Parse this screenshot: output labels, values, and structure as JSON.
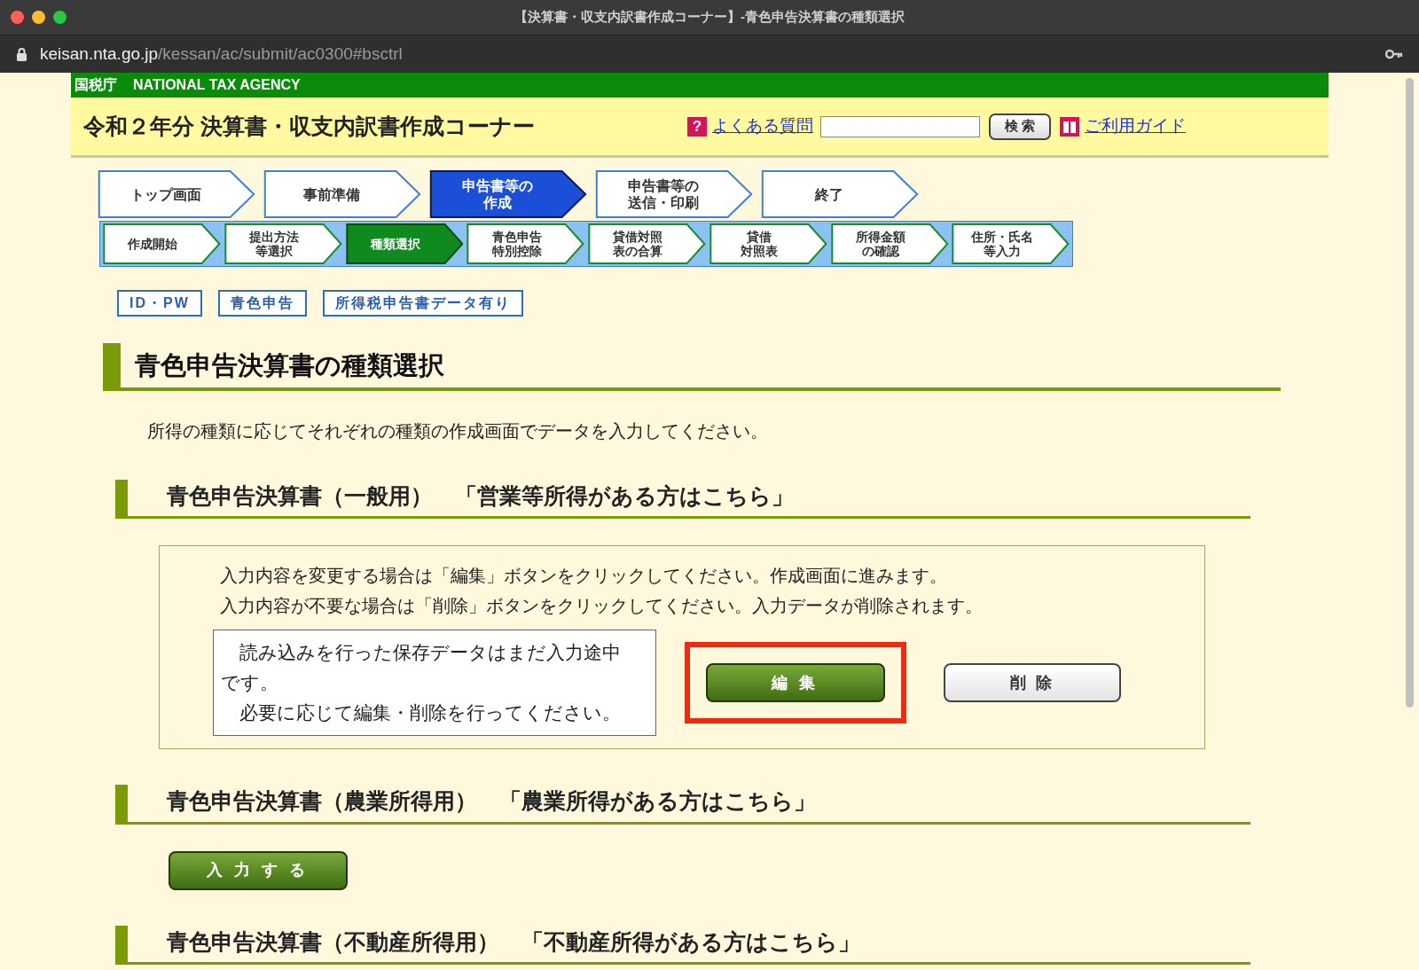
{
  "window": {
    "title": "【決算書・収支内訳書作成コーナー】-青色申告決算書の種類選択",
    "url_host": "keisan.nta.go.jp",
    "url_path": "/kessan/ac/submit/ac0300#bsctrl"
  },
  "agency_bar": {
    "name_ja": "国税庁",
    "name_en": "NATIONAL TAX AGENCY"
  },
  "header": {
    "title": "令和２年分 決算書・収支内訳書作成コーナー",
    "faq_icon": "?",
    "faq_link": "よくある質問",
    "search_button": "検 索",
    "guide_link": "ご利用ガイド"
  },
  "main_steps": [
    {
      "lines": [
        "トップ画面"
      ],
      "selected": false
    },
    {
      "lines": [
        "事前準備"
      ],
      "selected": false
    },
    {
      "lines": [
        "申告書等の",
        "作成"
      ],
      "selected": true
    },
    {
      "lines": [
        "申告書等の",
        "送信・印刷"
      ],
      "selected": false
    },
    {
      "lines": [
        "終了"
      ],
      "selected": false
    }
  ],
  "sub_steps": [
    {
      "lines": [
        "作成開始"
      ],
      "selected": false
    },
    {
      "lines": [
        "提出方法",
        "等選択"
      ],
      "selected": false
    },
    {
      "lines": [
        "種類選択"
      ],
      "selected": true
    },
    {
      "lines": [
        "青色申告",
        "特別控除"
      ],
      "selected": false
    },
    {
      "lines": [
        "貸借対照",
        "表の合算"
      ],
      "selected": false
    },
    {
      "lines": [
        "貸借",
        "対照表"
      ],
      "selected": false
    },
    {
      "lines": [
        "所得金額",
        "の確認"
      ],
      "selected": false
    },
    {
      "lines": [
        "住所・氏名",
        "等入力"
      ],
      "selected": false
    }
  ],
  "badges": [
    "ID・PW",
    "青色申告",
    "所得税申告書データ有り"
  ],
  "page_heading": "青色申告決算書の種類選択",
  "intro": "所得の種類に応じてそれぞれの種類の作成画面でデータを入力してください。",
  "sections": [
    {
      "kind": "edit",
      "heading": "青色申告決算書（一般用）　「営業等所得がある方はこちら」",
      "instructions": [
        "入力内容を変更する場合は「編集」ボタンをクリックしてください。作成画面に進みます。",
        "入力内容が不要な場合は「削除」ボタンをクリックしてください。入力データが削除されます。"
      ],
      "notice": [
        "　読み込みを行った保存データはまだ入力途中です。",
        "　必要に応じて編集・削除を行ってください。"
      ],
      "edit_button": {
        "label": "編 集",
        "highlighted": true
      },
      "delete_button": {
        "label": "削 除",
        "highlighted": false
      }
    },
    {
      "kind": "input",
      "heading": "青色申告決算書（農業所得用）　「農業所得がある方はこちら」",
      "input_button": "入 力 す る"
    },
    {
      "kind": "heading",
      "heading": "青色申告決算書（不動産所得用）　「不動産所得がある方はこちら」"
    }
  ]
}
